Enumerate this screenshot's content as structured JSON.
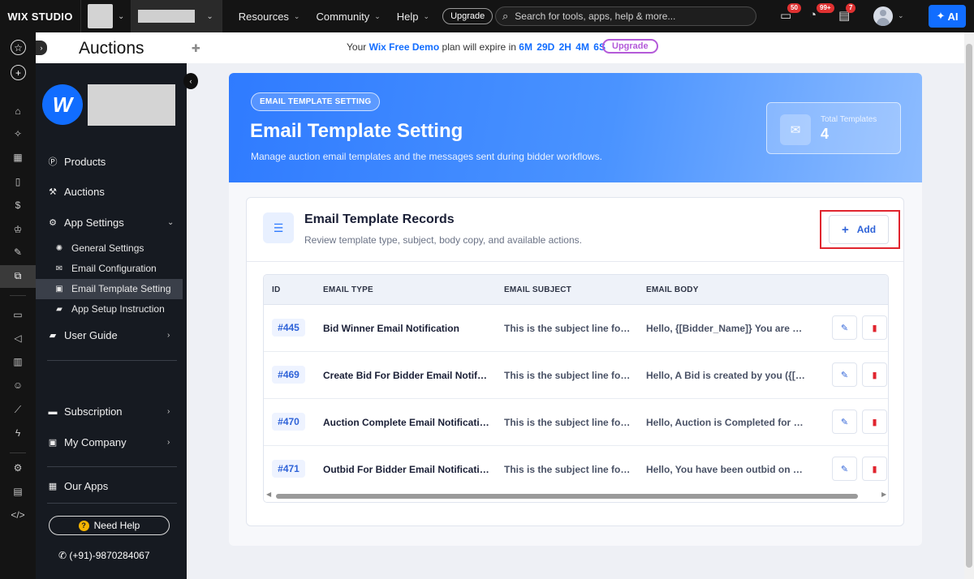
{
  "topbar": {
    "logo": "WIX STUDIO",
    "nav": [
      "Resources",
      "Community",
      "Help"
    ],
    "upgrade_label": "Upgrade",
    "search_placeholder": "Search for tools, apps, help & more...",
    "badges": {
      "messages": "50",
      "notifications": "99+",
      "updates": "7"
    },
    "ai_label": "AI"
  },
  "header": {
    "title": "Auctions",
    "notice_prefix": "Your",
    "plan_name": "Wix Free Demo",
    "notice_mid": "plan will expire in",
    "countdown": "6M  29D  2H  4M  6S",
    "upgrade_label": "Upgrade"
  },
  "sidebar": {
    "items": [
      {
        "label": "Products",
        "icon": "products-icon"
      },
      {
        "label": "Auctions",
        "icon": "gavel-icon"
      },
      {
        "label": "App Settings",
        "icon": "settings-icon"
      }
    ],
    "subitems": [
      {
        "label": "General Settings",
        "icon": "gear-icon"
      },
      {
        "label": "Email Configuration",
        "icon": "envelope-icon"
      },
      {
        "label": "Email Template Setting",
        "icon": "id-card-icon"
      },
      {
        "label": "App Setup Instruction",
        "icon": "book-icon"
      }
    ],
    "user_guide": "User Guide",
    "subscription": "Subscription",
    "my_company": "My Company",
    "our_apps": "Our Apps",
    "need_help": "Need Help",
    "phone": "(+91)-9870284067"
  },
  "hero": {
    "pill": "EMAIL TEMPLATE SETTING",
    "title": "Email Template Setting",
    "subtitle": "Manage auction email templates and the messages sent during bidder workflows.",
    "stat_label": "Total Templates",
    "stat_value": "4"
  },
  "records": {
    "title": "Email Template Records",
    "subtitle": "Review template type, subject, body copy, and available actions.",
    "add_label": "Add",
    "columns": [
      "ID",
      "EMAIL TYPE",
      "EMAIL SUBJECT",
      "EMAIL BODY"
    ],
    "rows": [
      {
        "id": "#445",
        "type": "Bid Winner Email Notification",
        "subject": "This is the subject line for ...",
        "body": "Hello, {[Bidder_Name]} You are th..."
      },
      {
        "id": "#469",
        "type": "Create Bid For Bidder Email Notific...",
        "subject": "This is the subject line for ...",
        "body": "Hello, A Bid is created by you ({[B..."
      },
      {
        "id": "#470",
        "type": "Auction Complete Email Notification",
        "subject": "This is the subject line for ...",
        "body": "Hello, Auction is Completed for P..."
      },
      {
        "id": "#471",
        "type": "Outbid For Bidder Email Notification",
        "subject": "This is the subject line for ...",
        "body": "Hello, You have been outbid on y..."
      }
    ]
  }
}
